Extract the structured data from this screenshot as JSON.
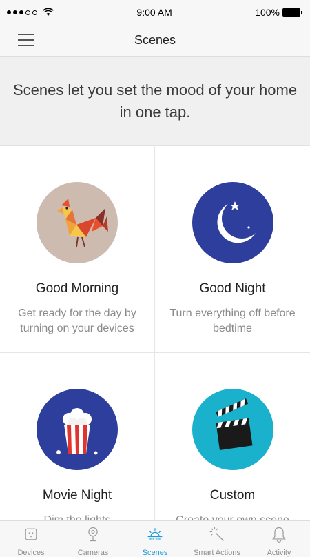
{
  "status_bar": {
    "time": "9:00 AM",
    "battery": "100%",
    "wifi_icon": "wifi-icon"
  },
  "nav": {
    "title": "Scenes",
    "menu_icon": "hamburger-menu-icon"
  },
  "banner": {
    "text": "Scenes let you set the mood of your home in one tap."
  },
  "scenes": [
    {
      "title": "Good Morning",
      "description": "Get ready for the day by turning on your devices",
      "icon": "rooster-icon",
      "color": "#cdbbb0"
    },
    {
      "title": "Good Night",
      "description": "Turn everything off before bedtime",
      "icon": "moon-stars-icon",
      "color": "#2d3e9c"
    },
    {
      "title": "Movie Night",
      "description": "Dim the lights",
      "icon": "popcorn-icon",
      "color": "#2d3e9c"
    },
    {
      "title": "Custom",
      "description": "Create your own scene",
      "icon": "clapperboard-icon",
      "color": "#1ab1cd"
    }
  ],
  "tabs": [
    {
      "label": "Devices",
      "icon": "outlet-icon",
      "active": false
    },
    {
      "label": "Cameras",
      "icon": "camera-icon",
      "active": false
    },
    {
      "label": "Scenes",
      "icon": "sunrise-icon",
      "active": true
    },
    {
      "label": "Smart Actions",
      "icon": "magic-wand-icon",
      "active": false
    },
    {
      "label": "Activity",
      "icon": "bell-icon",
      "active": false
    }
  ],
  "colors": {
    "accent": "#1a9bd7",
    "inactive": "#8e8e8e"
  }
}
